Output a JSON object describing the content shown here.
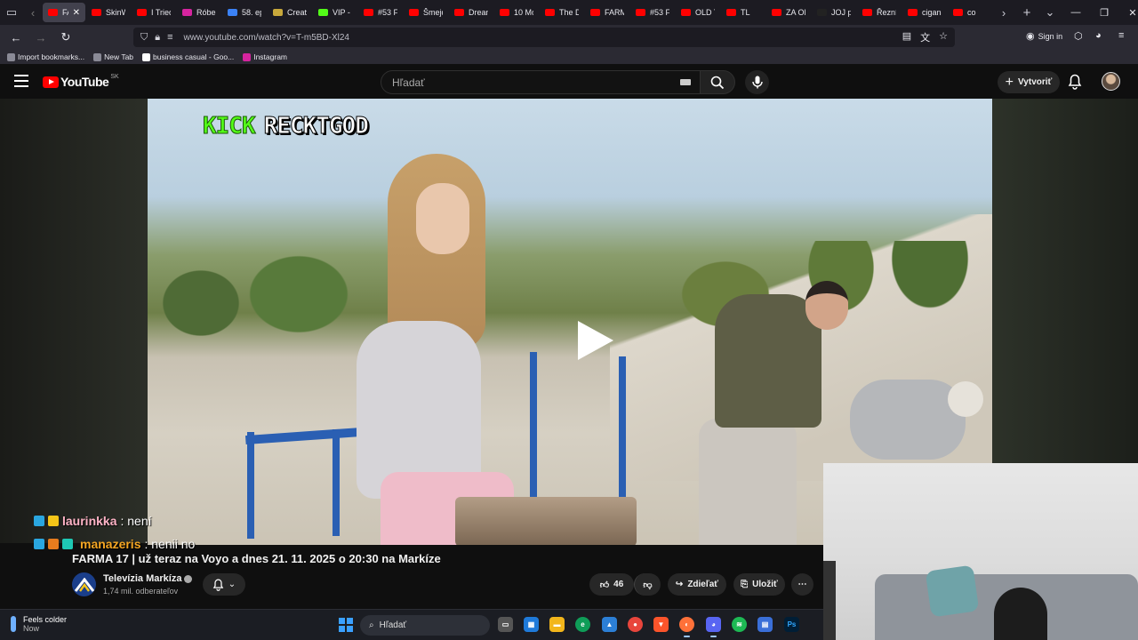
{
  "browser": {
    "tabs": [
      {
        "label": "FAR",
        "active": true,
        "color": "#ff0000"
      },
      {
        "label": "SkinW",
        "color": "#ff0000"
      },
      {
        "label": "I Tried",
        "color": "#ff0000"
      },
      {
        "label": "Róber",
        "color": "#d6249f"
      },
      {
        "label": "58. ep",
        "color": "#3b82f6"
      },
      {
        "label": "Create",
        "color": "#c8a83b"
      },
      {
        "label": "VIP - F",
        "color": "#53fc18"
      },
      {
        "label": "#53 F",
        "color": "#ff0000"
      },
      {
        "label": "Šmejd",
        "color": "#ff0000"
      },
      {
        "label": "Dream",
        "color": "#ff0000"
      },
      {
        "label": "10 Mo",
        "color": "#ff0000"
      },
      {
        "label": "The D",
        "color": "#ff0000"
      },
      {
        "label": "FARM",
        "color": "#ff0000"
      },
      {
        "label": "#53 F",
        "color": "#ff0000"
      },
      {
        "label": "OLD T",
        "color": "#ff0000"
      },
      {
        "label": "TL",
        "color": "#ff0000"
      },
      {
        "label": "ZA OF",
        "color": "#ff0000"
      },
      {
        "label": "JOJ play",
        "color": "#222222"
      },
      {
        "label": "Řezník",
        "color": "#ff0000"
      },
      {
        "label": "cigans",
        "color": "#ff0000"
      },
      {
        "label": "co",
        "color": "#ff0000"
      }
    ],
    "url": "www.youtube.com/watch?v=T-m5BD-Xl24",
    "sign_in": "Sign in",
    "bookmarks": [
      {
        "label": "Import bookmarks...",
        "color": "#8a8a96"
      },
      {
        "label": "New Tab",
        "color": "#8a8a96"
      },
      {
        "label": "business casual - Goo...",
        "color": "#ffffff"
      },
      {
        "label": "Instagram",
        "color": "#d6249f"
      }
    ]
  },
  "youtube": {
    "logo_text": "YouTube",
    "country_code": "SK",
    "search_placeholder": "Hľadať",
    "create_label": "Vytvoriť"
  },
  "video": {
    "overlay_kick": "KICK",
    "overlay_name": "RECKTGOD",
    "title": "FARMA 17 | už teraz na Voyo a dnes 21. 11. 2025 o 20:30 na Markíze",
    "channel_name": "Televízia Markíza",
    "subscribers": "1,74 mil. odberateľov",
    "likes": "46",
    "share_label": "Zdieľať",
    "save_label": "Uložiť"
  },
  "chat": [
    {
      "user": "laurinkka",
      "message": ": není",
      "user_color": "#ffb3c6"
    },
    {
      "user": "manazeris",
      "message": ": nenii no",
      "user_color": "#f5a623"
    }
  ],
  "taskbar": {
    "weather_line1": "Feels colder",
    "weather_line2": "Now",
    "search_label": "Hľadať"
  },
  "colors": {
    "accent_red": "#ff0000",
    "kick_green": "#53fc18",
    "yt_bg": "#0f0f0f"
  }
}
